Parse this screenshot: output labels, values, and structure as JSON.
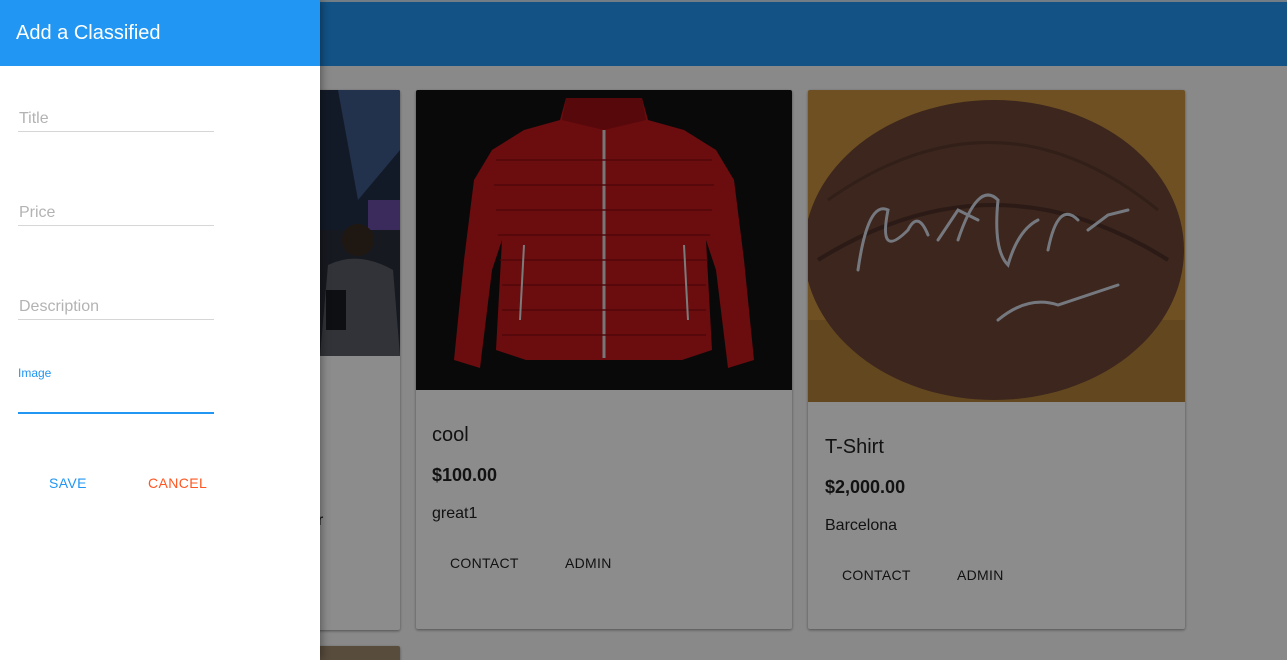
{
  "drawer": {
    "title": "Add a Classified",
    "fields": [
      {
        "name": "title",
        "placeholder": "Title",
        "value": ""
      },
      {
        "name": "price",
        "placeholder": "Price",
        "value": ""
      },
      {
        "name": "description",
        "placeholder": "Description",
        "value": ""
      },
      {
        "name": "image",
        "label": "Image",
        "value": ""
      }
    ],
    "save_label": "SAVE",
    "cancel_label": "CANCEL"
  },
  "colors": {
    "primary": "#2196f3",
    "cancel": "#ff5722",
    "overlay": "rgba(0,0,0,0.45)"
  },
  "cards": [
    {
      "title": "",
      "price": "",
      "description": "r",
      "image": "conference-crowd-photo"
    },
    {
      "title": "cool",
      "price": "$100.00",
      "description": "great1",
      "contact_label": "CONTACT",
      "admin_label": "ADMIN",
      "image": "red-puffer-jacket-photo"
    },
    {
      "title": "T-Shirt",
      "price": "$2,000.00",
      "description": "Barcelona",
      "contact_label": "CONTACT",
      "admin_label": "ADMIN",
      "image": "signed-football-photo"
    }
  ]
}
